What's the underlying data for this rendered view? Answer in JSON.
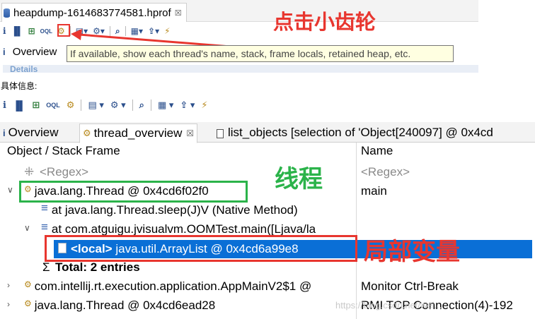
{
  "top": {
    "file_tab": "heapdump-1614683774581.hprof",
    "file_tab_close": "☒",
    "annotation": "点击小齿轮",
    "tooltip": "If available, show each thread's name, stack, frame locals, retained heap, etc.",
    "overview_icon": "i",
    "overview_label": "Overview",
    "details_cut": "Details"
  },
  "caption": "具体信息:",
  "toolbar": {
    "icons": [
      "info-icon",
      "histogram-icon",
      "dominator-tree-icon",
      "oql-icon",
      "thread-overview-gear-icon",
      "run-report-icon",
      "query-browser-icon",
      "search-icon",
      "layout-icon",
      "export-icon",
      "calculate-retained-icon"
    ]
  },
  "tabs": [
    {
      "label": "Overview",
      "icon": "i"
    },
    {
      "label": "thread_overview",
      "icon": "gear",
      "close": "☒"
    },
    {
      "label": "list_objects  [selection of 'Object[240097] @ 0x4cd",
      "icon": "doc"
    }
  ],
  "columns": {
    "object": "Object / Stack Frame",
    "name": "Name"
  },
  "rows": {
    "regex": {
      "object": "<Regex>",
      "name": "<Regex>"
    },
    "thread1": {
      "object": "java.lang.Thread @ 0x4cd6f02f0",
      "name": "main"
    },
    "frame1": {
      "object": "at java.lang.Thread.sleep(J)V (Native Method)"
    },
    "frame2": {
      "object": "at com.atguigu.jvisualvm.OOMTest.main([Ljava/la"
    },
    "local": {
      "tag": "<local>",
      "object": " java.util.ArrayList @ 0x4cd6a99e8"
    },
    "total": {
      "object": "Total: 2 entries"
    },
    "thread2": {
      "object": "com.intellij.rt.execution.application.AppMainV2$1 @",
      "name": "Monitor Ctrl-Break"
    },
    "thread3": {
      "object": "java.lang.Thread @ 0x4cd6ead28",
      "name": "RMI TCP Connection(4)-192"
    }
  },
  "annotations": {
    "thread": "线程",
    "local_vars": "局部变量"
  },
  "watermark": "https://blog.csdn.net/wei...",
  "colors": {
    "red": "#e8362f",
    "green": "#2bb34a",
    "selection": "#0a6fd6"
  }
}
